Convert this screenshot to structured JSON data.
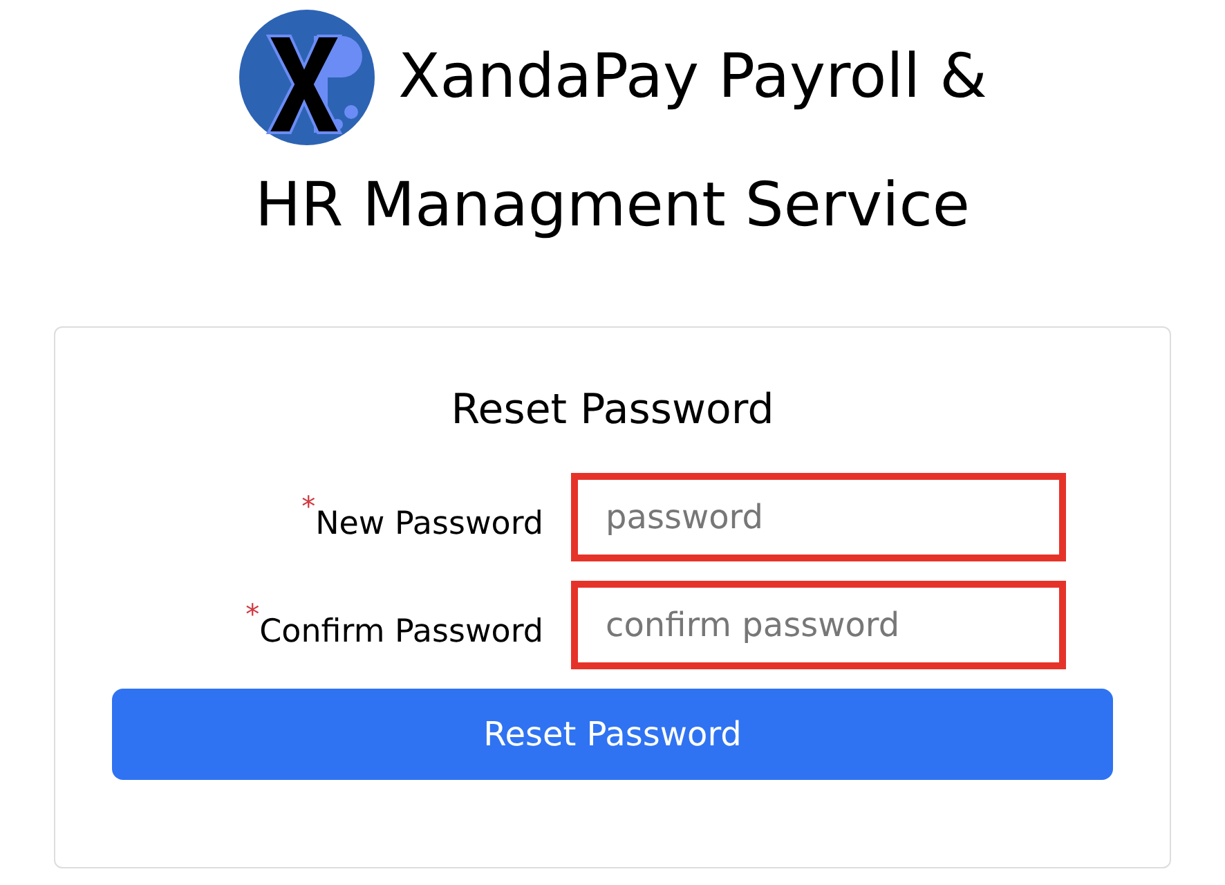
{
  "header": {
    "title_lines": [
      "XandaPay Payroll &",
      "HR Managment Service"
    ]
  },
  "form": {
    "heading": "Reset Password",
    "fields": [
      {
        "required_mark": "*",
        "label": "New Password",
        "placeholder": "password",
        "highlighted": true
      },
      {
        "required_mark": "*",
        "label": "Confirm Password",
        "placeholder": "confirm password",
        "highlighted": true
      }
    ],
    "submit": "Reset Password"
  }
}
